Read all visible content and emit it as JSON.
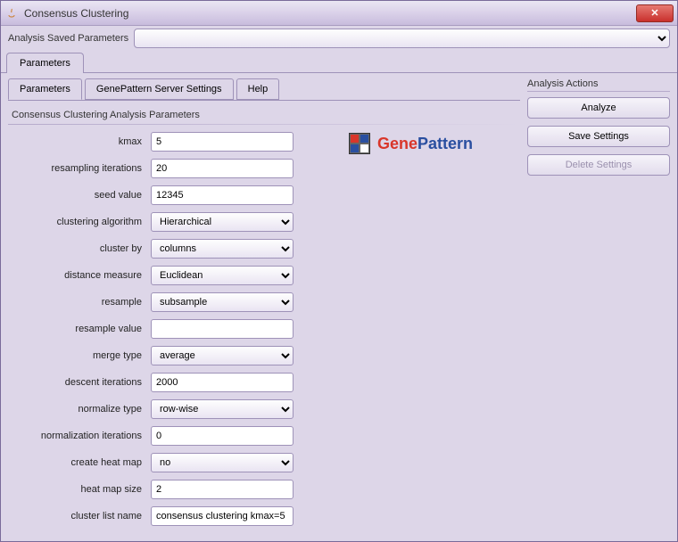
{
  "window": {
    "title": "Consensus Clustering"
  },
  "saved": {
    "label": "Analysis Saved Parameters",
    "selected": ""
  },
  "outer_tabs": {
    "parameters": "Parameters"
  },
  "inner_tabs": {
    "parameters": "Parameters",
    "server_settings": "GenePattern Server Settings",
    "help": "Help"
  },
  "fieldset_title": "Consensus Clustering Analysis Parameters",
  "logo": {
    "text_gene": "Gene",
    "text_pattern": "Pattern"
  },
  "params": {
    "kmax": {
      "label": "kmax",
      "value": "5"
    },
    "resampling_iterations": {
      "label": "resampling iterations",
      "value": "20"
    },
    "seed_value": {
      "label": "seed value",
      "value": "12345"
    },
    "clustering_algorithm": {
      "label": "clustering algorithm",
      "value": "Hierarchical"
    },
    "cluster_by": {
      "label": "cluster by",
      "value": "columns"
    },
    "distance_measure": {
      "label": "distance measure",
      "value": "Euclidean"
    },
    "resample": {
      "label": "resample",
      "value": "subsample"
    },
    "resample_value": {
      "label": "resample value",
      "value": ""
    },
    "merge_type": {
      "label": "merge type",
      "value": "average"
    },
    "descent_iterations": {
      "label": "descent iterations",
      "value": "2000"
    },
    "normalize_type": {
      "label": "normalize type",
      "value": "row-wise"
    },
    "normalization_iterations": {
      "label": "normalization iterations",
      "value": "0"
    },
    "create_heat_map": {
      "label": "create heat map",
      "value": "no"
    },
    "heat_map_size": {
      "label": "heat map size",
      "value": "2"
    },
    "cluster_list_name": {
      "label": "cluster list name",
      "value": "consensus clustering kmax=5"
    }
  },
  "actions": {
    "title": "Analysis Actions",
    "analyze": "Analyze",
    "save_settings": "Save Settings",
    "delete_settings": "Delete Settings"
  }
}
